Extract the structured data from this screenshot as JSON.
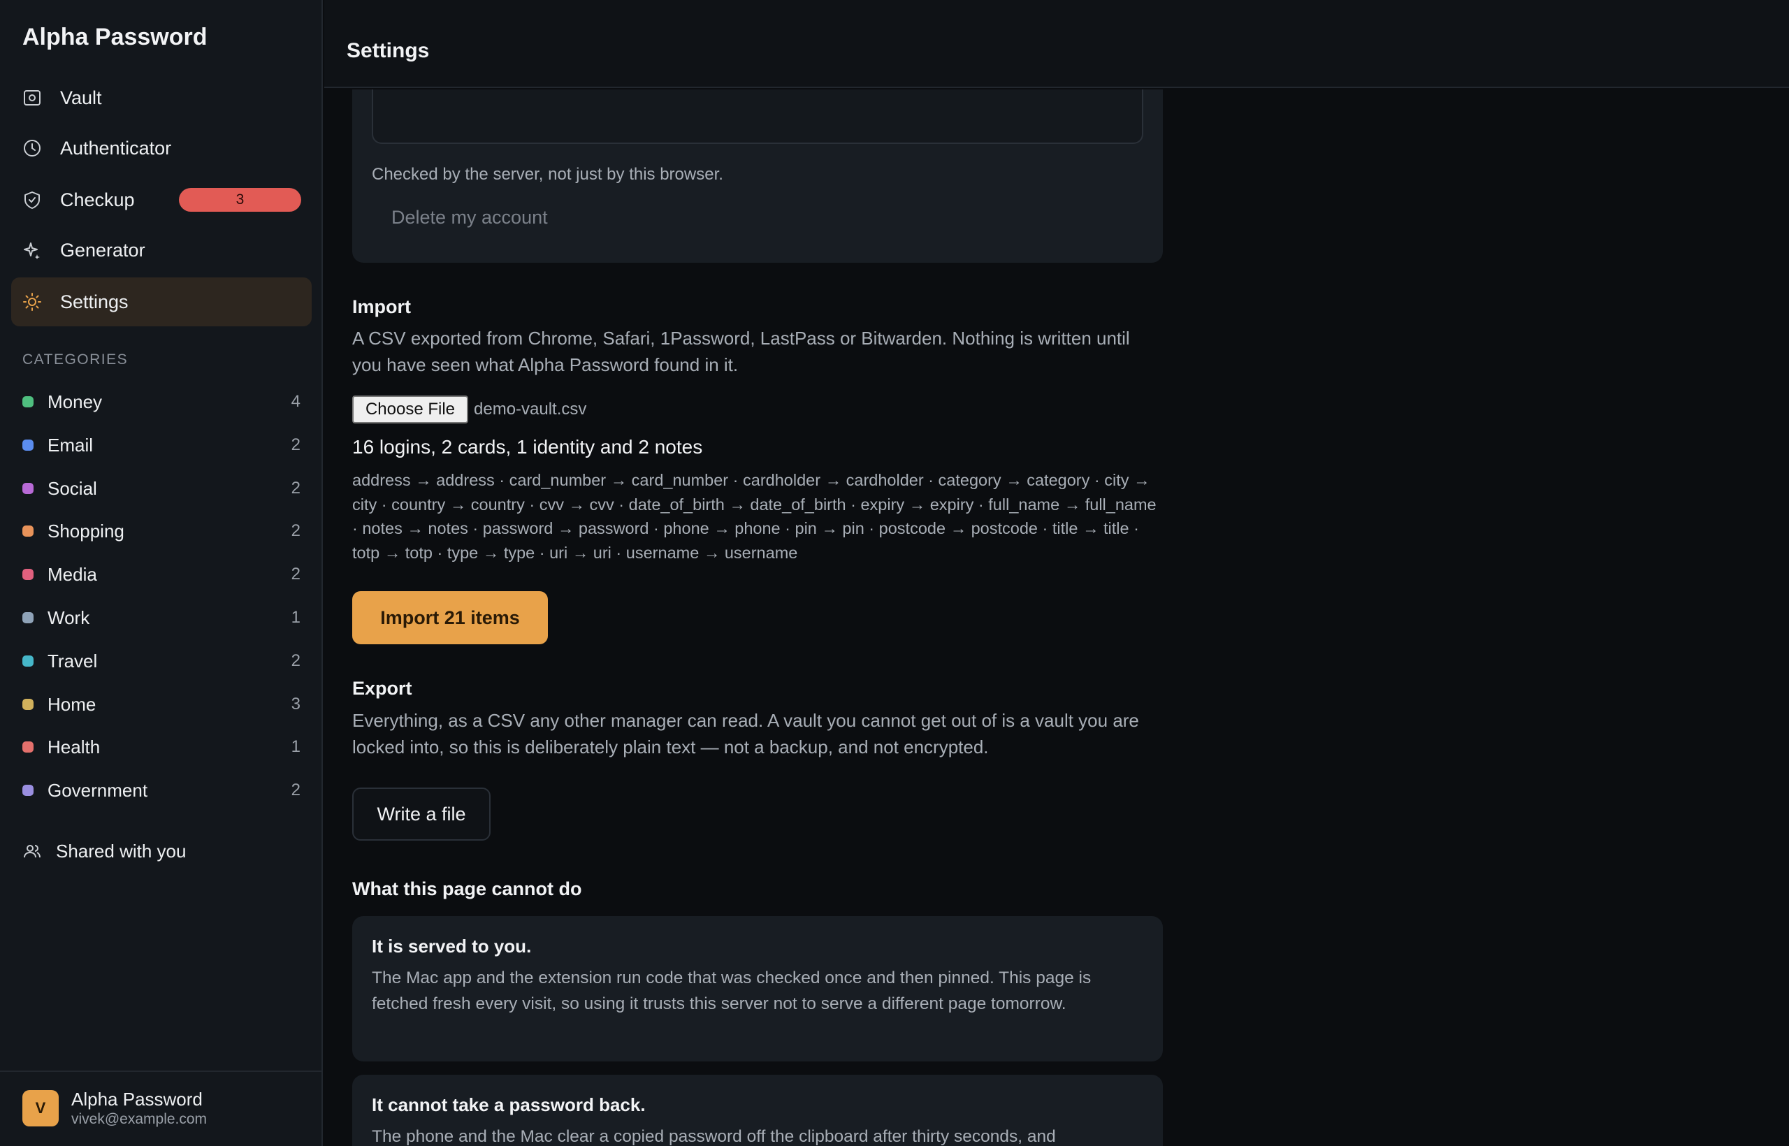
{
  "app": {
    "brand": "Alpha Password"
  },
  "nav": {
    "items": [
      {
        "label": "Vault",
        "icon": "vault-icon"
      },
      {
        "label": "Authenticator",
        "icon": "clock-icon"
      },
      {
        "label": "Checkup",
        "icon": "shield-check-icon",
        "badge": "3"
      },
      {
        "label": "Generator",
        "icon": "sparkle-icon"
      },
      {
        "label": "Settings",
        "icon": "sun-gear-icon",
        "active": true
      }
    ]
  },
  "categories": {
    "heading": "CATEGORIES",
    "items": [
      {
        "name": "Money",
        "count": "4",
        "color": "#4fbf7f"
      },
      {
        "name": "Email",
        "count": "2",
        "color": "#5b8def"
      },
      {
        "name": "Social",
        "count": "2",
        "color": "#b86ad6"
      },
      {
        "name": "Shopping",
        "count": "2",
        "color": "#e8935a"
      },
      {
        "name": "Media",
        "count": "2",
        "color": "#e0607e"
      },
      {
        "name": "Work",
        "count": "1",
        "color": "#8fa3b8"
      },
      {
        "name": "Travel",
        "count": "2",
        "color": "#46b7c9"
      },
      {
        "name": "Home",
        "count": "3",
        "color": "#d1b15c"
      },
      {
        "name": "Health",
        "count": "1",
        "color": "#e4706c"
      },
      {
        "name": "Government",
        "count": "2",
        "color": "#9a8fe0"
      }
    ]
  },
  "shared": {
    "label": "Shared with you"
  },
  "account": {
    "initial": "V",
    "name": "Alpha Password",
    "email": "vivek@example.com"
  },
  "header": {
    "title": "Settings"
  },
  "delete_account": {
    "hint": "Checked by the server, not just by this browser.",
    "button": "Delete my account"
  },
  "import": {
    "title": "Import",
    "description": "A CSV exported from Chrome, Safari, 1Password, LastPass or Bitwarden. Nothing is written until you have seen what Alpha Password found in it.",
    "choose_file": "Choose File",
    "file_name": "demo-vault.csv",
    "summary": "16 logins, 2 cards, 1 identity and 2 notes",
    "mapping": "address → address · card_number → card_number · cardholder → cardholder · category → category · city → city · country → country · cvv → cvv · date_of_birth → date_of_birth · expiry → expiry · full_name → full_name · notes → notes · password → password · phone → phone · pin → pin · postcode → postcode · title → title · totp → totp · type → type · uri → uri · username → username",
    "button": "Import 21 items"
  },
  "export": {
    "title": "Export",
    "description": "Everything, as a CSV any other manager can read. A vault you cannot get out of is a vault you are locked into, so this is deliberately plain text — not a backup, and not encrypted.",
    "button": "Write a file"
  },
  "limits": {
    "title": "What this page cannot do",
    "cards": [
      {
        "title": "It is served to you.",
        "body": "The Mac app and the extension run code that was checked once and then pinned. This page is fetched fresh every visit, so using it trusts this server not to serve a different page tomorrow."
      },
      {
        "title": "It cannot take a password back.",
        "body": "The phone and the Mac clear a copied password off the clipboard after thirty seconds, and"
      }
    ]
  }
}
